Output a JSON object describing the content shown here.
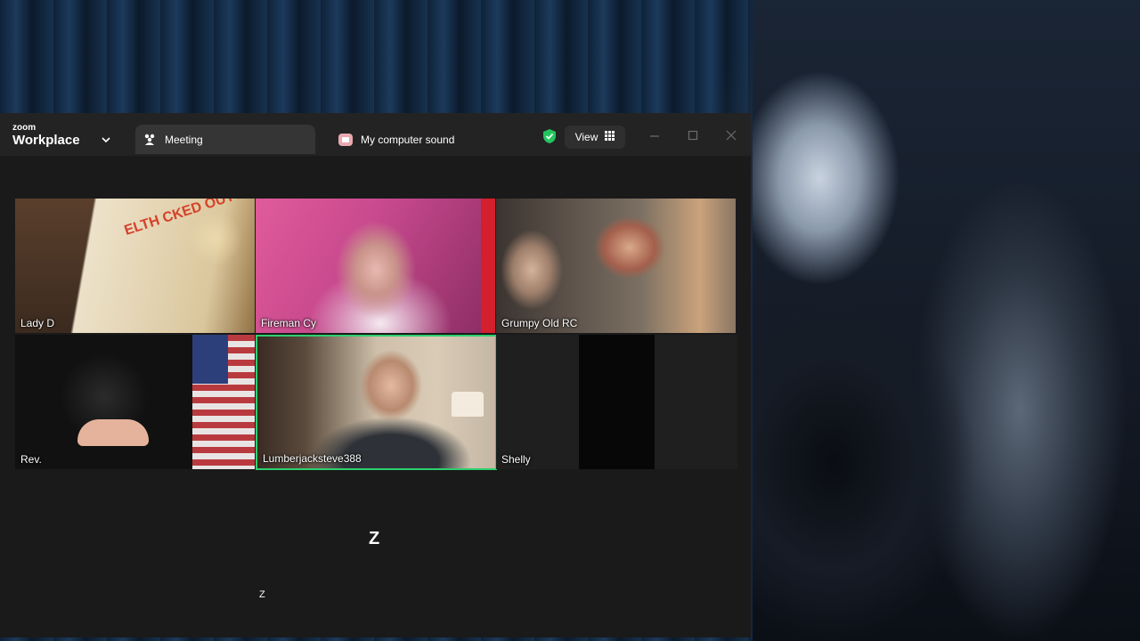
{
  "app": {
    "brand_top": "zoom",
    "brand_main": "Workplace"
  },
  "tabs": [
    {
      "label": "Meeting",
      "icon": "people-icon",
      "active": true
    },
    {
      "label": "My computer sound",
      "icon": "sound-icon",
      "active": false
    }
  ],
  "toolbar": {
    "view_label": "View",
    "shield_color": "#22c55e"
  },
  "participants": [
    {
      "name": "Lady D"
    },
    {
      "name": "Fireman Cy"
    },
    {
      "name": "Grumpy Old RC"
    },
    {
      "name": "Rev."
    },
    {
      "name": "Lumberjacksteve388",
      "active_speaker": true
    },
    {
      "name": "Shelly"
    }
  ],
  "tile_text": {
    "poster": "ELTH CKED OUT?"
  },
  "overlay": {
    "big": "Z",
    "small": "Z"
  },
  "colors": {
    "window_bg": "#1a1a1a",
    "titlebar_bg": "#232323",
    "active_tab_bg": "#353535",
    "speaker_border": "#2ed06e"
  }
}
